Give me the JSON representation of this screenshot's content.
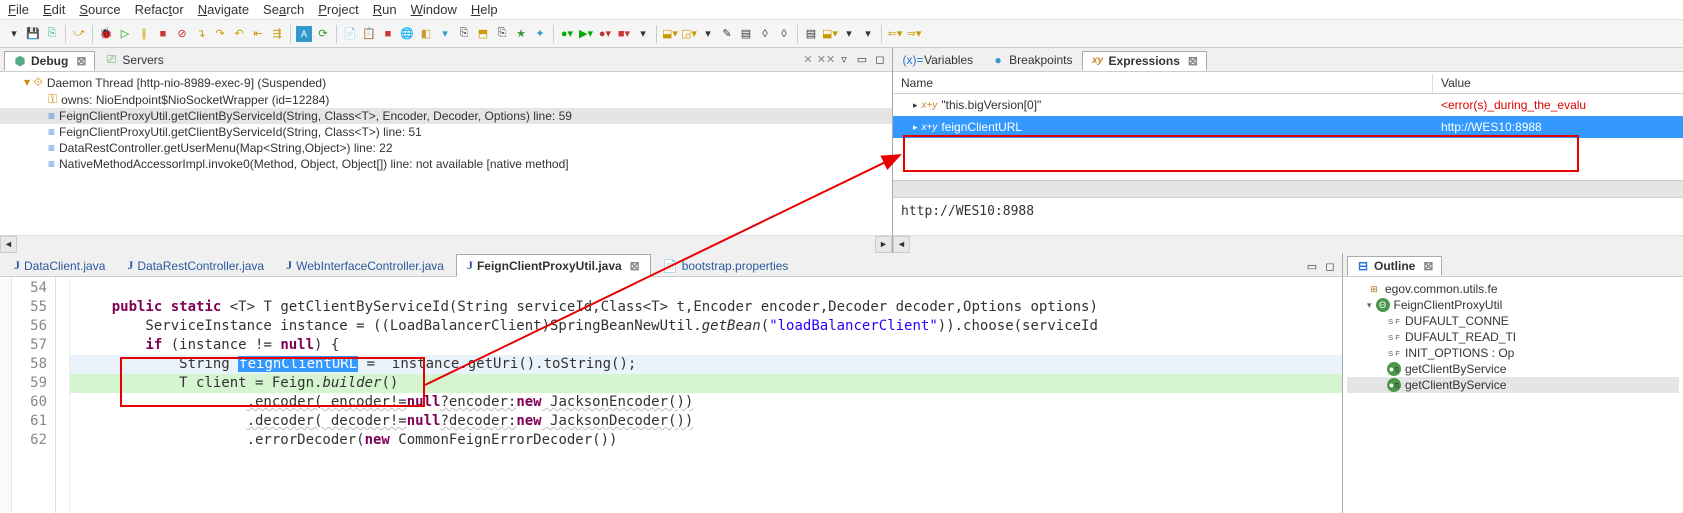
{
  "menu": [
    "File",
    "Edit",
    "Source",
    "Refactor",
    "Navigate",
    "Search",
    "Project",
    "Run",
    "Window",
    "Help"
  ],
  "debug": {
    "tab_debug": "Debug",
    "tab_servers": "Servers",
    "stack": [
      {
        "icon": "thread",
        "text": "Daemon Thread [http-nio-8989-exec-9] (Suspended)",
        "indent": 20
      },
      {
        "icon": "key",
        "text": "owns: NioEndpoint$NioSocketWrapper  (id=12284)",
        "indent": 44
      },
      {
        "icon": "frame",
        "text": "FeignClientProxyUtil.getClientByServiceId(String, Class<T>, Encoder, Decoder, Options) line: 59",
        "indent": 44,
        "sel": true
      },
      {
        "icon": "frame",
        "text": "FeignClientProxyUtil.getClientByServiceId(String, Class<T>) line: 51",
        "indent": 44
      },
      {
        "icon": "frame",
        "text": "DataRestController.getUserMenu(Map<String,Object>) line: 22",
        "indent": 44
      },
      {
        "icon": "frame",
        "text": "NativeMethodAccessorImpl.invoke0(Method, Object, Object[]) line: not available [native method]",
        "indent": 44
      }
    ]
  },
  "vars": {
    "tab_variables": "Variables",
    "tab_breakpoints": "Breakpoints",
    "tab_expressions": "Expressions",
    "hdr_name": "Name",
    "hdr_value": "Value",
    "rows": [
      {
        "name": "\"this.bigVersion[0]\"",
        "value": "<error(s)_during_the_evalu",
        "err": true
      },
      {
        "name": "feignClientURL",
        "value": "http://WES10:8988",
        "sel": true
      }
    ],
    "detail": "http://WES10:8988"
  },
  "editor": {
    "tabs": [
      {
        "label": "DataClient.java"
      },
      {
        "label": "DataRestController.java"
      },
      {
        "label": "WebInterfaceController.java"
      },
      {
        "label": "FeignClientProxyUtil.java",
        "active": true
      },
      {
        "label": "bootstrap.properties"
      }
    ],
    "lines": [
      54,
      55,
      56,
      57,
      58,
      59,
      60,
      61,
      62
    ]
  },
  "outline": {
    "tab": "Outline",
    "items": [
      {
        "icon": "pkg",
        "text": "egov.common.utils.fe",
        "indent": 14
      },
      {
        "icon": "cls",
        "text": "FeignClientProxyUtil",
        "indent": 14,
        "expander": "▾"
      },
      {
        "icon": "fld",
        "text": "DUFAULT_CONNE",
        "indent": 34
      },
      {
        "icon": "fld",
        "text": "DUFAULT_READ_TI",
        "indent": 34
      },
      {
        "icon": "fld",
        "text": "INIT_OPTIONS : Op",
        "indent": 34
      },
      {
        "icon": "mtd",
        "text": "getClientByService",
        "indent": 34
      },
      {
        "icon": "mtd",
        "text": "getClientByService",
        "indent": 34,
        "sel": true
      }
    ]
  }
}
